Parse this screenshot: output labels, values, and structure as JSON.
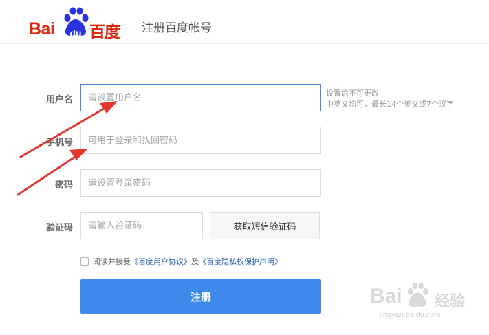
{
  "header": {
    "logo_latin": "Bai",
    "logo_du": "du",
    "logo_cn": "百度",
    "title": "注册百度帐号"
  },
  "form": {
    "username": {
      "label": "用户名",
      "placeholder": "请设置用户名",
      "hint_line1": "设置后不可更改",
      "hint_line2": "中英文均可，最长14个英文或7个汉字"
    },
    "phone": {
      "label": "手机号",
      "placeholder": "可用于登录和找回密码"
    },
    "password": {
      "label": "密码",
      "placeholder": "请设置登录密码"
    },
    "captcha": {
      "label": "验证码",
      "placeholder": "请输入验证码",
      "button": "获取短信验证码"
    },
    "agreement": {
      "prefix": "阅读并接受",
      "link1": "《百度用户协议》",
      "middle": "及",
      "link2": "《百度隐私权保护声明》",
      "checked": false
    },
    "submit": "注册"
  },
  "colors": {
    "brand_red": "#de2910",
    "brand_blue": "#2932e1",
    "primary_button": "#3f89ec",
    "annotation_arrow": "#e0372f"
  },
  "watermark": {
    "latin": "Bai",
    "cn": "经验",
    "url": "jingyan.baidu.com"
  }
}
